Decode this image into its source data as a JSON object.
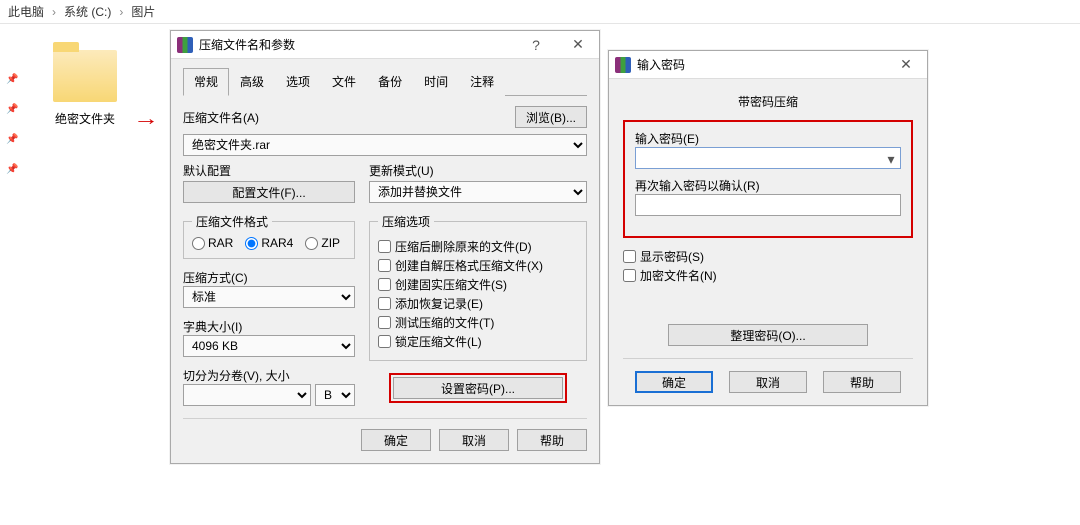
{
  "breadcrumb": {
    "seg1": "此电脑",
    "seg2": "系统 (C:)",
    "seg3": "图片",
    "sep": "›"
  },
  "folder": {
    "name": "绝密文件夹"
  },
  "dlg1": {
    "title": "压缩文件名和参数",
    "help_glyph": "?",
    "close_glyph": "✕",
    "tabs": {
      "general": "常规",
      "advanced": "高级",
      "options": "选项",
      "files": "文件",
      "backup": "备份",
      "time": "时间",
      "comment": "注释"
    },
    "archive_name_label": "压缩文件名(A)",
    "archive_name_value": "绝密文件夹.rar",
    "browse_btn": "浏览(B)...",
    "default_profile_label": "默认配置",
    "profiles_btn": "配置文件(F)...",
    "update_mode_label": "更新模式(U)",
    "update_mode_value": "添加并替换文件",
    "format_legend": "压缩文件格式",
    "format": {
      "rar": "RAR",
      "rar4": "RAR4",
      "zip": "ZIP"
    },
    "method_label": "压缩方式(C)",
    "method_value": "标准",
    "dict_label": "字典大小(I)",
    "dict_value": "4096 KB",
    "split_label": "切分为分卷(V), 大小",
    "split_unit": "B",
    "options_legend": "压缩选项",
    "opt_delete": "压缩后删除原来的文件(D)",
    "opt_sfx": "创建自解压格式压缩文件(X)",
    "opt_solid": "创建固实压缩文件(S)",
    "opt_recovery": "添加恢复记录(E)",
    "opt_test": "测试压缩的文件(T)",
    "opt_lock": "锁定压缩文件(L)",
    "set_password_btn": "设置密码(P)...",
    "ok": "确定",
    "cancel": "取消",
    "help": "帮助"
  },
  "dlg2": {
    "title": "输入密码",
    "close_glyph": "✕",
    "subtitle": "带密码压缩",
    "enter_pw_label": "输入密码(E)",
    "enter_pw_value": "",
    "reenter_label": "再次输入密码以确认(R)",
    "reenter_value": "",
    "show_pw": "显示密码(S)",
    "encrypt_names": "加密文件名(N)",
    "organize_btn": "整理密码(O)...",
    "ok": "确定",
    "cancel": "取消",
    "help": "帮助"
  }
}
